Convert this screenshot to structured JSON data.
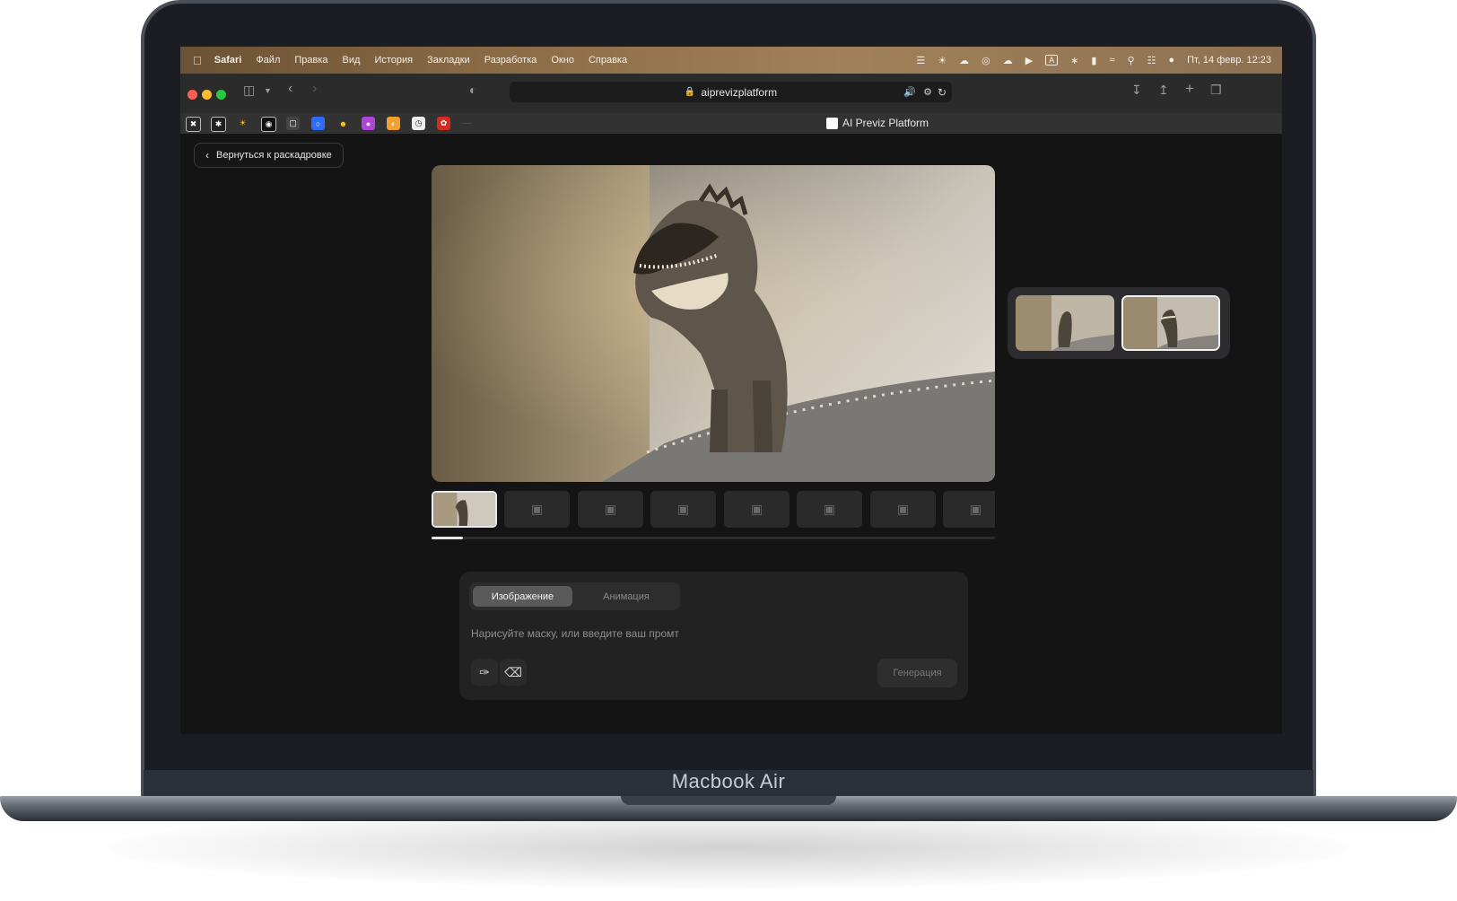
{
  "device": {
    "model_label": "Macbook Air"
  },
  "menubar": {
    "apple_icon": "apple-icon",
    "app_name": "Safari",
    "items": [
      "Файл",
      "Правка",
      "Вид",
      "История",
      "Закладки",
      "Разработка",
      "Окно",
      "Справка"
    ],
    "status_icons": [
      "figma-icon",
      "brightness-icon",
      "cloud-sync-icon",
      "eye-icon",
      "cloud-icon",
      "play-icon",
      "keyboard-layout-icon",
      "bluetooth-icon",
      "battery-icon",
      "wifi-icon",
      "search-icon",
      "control-center-icon",
      "siri-icon"
    ],
    "keyboard_layout": "A",
    "datetime": "Пт, 14 февр.  12:23"
  },
  "toolbar": {
    "url": "aiprevizplatform"
  },
  "tabbar": {
    "favorites": [
      "cursor-icon",
      "perplexity-icon",
      "sun-icon",
      "chatgpt-icon",
      "bubble-icon",
      "blue-app-icon",
      "emoji-icon",
      "figma-app-icon",
      "gradient-app-icon",
      "clock-app-icon",
      "red-app-icon",
      "line-icon"
    ],
    "active_tab_title": "AI Previz Platform"
  },
  "page": {
    "back_button_label": "Вернуться к раскадровке",
    "frame_count": 8,
    "active_frame": 1,
    "scroll_progress": 0.055,
    "variants_count": 2,
    "selected_variant": 2,
    "mode_tabs": [
      "Изображение",
      "Анимация"
    ],
    "active_mode": "Изображение",
    "prompt_placeholder": "Нарисуйте маску, или введите ваш промт",
    "generate_label": "Генерация"
  },
  "colors": {
    "background": "#141414",
    "panel": "#222222",
    "accent_active_tab": "#5a5a5a",
    "close": "#ff5f57",
    "minimize": "#febc2e",
    "zoom": "#28c840"
  }
}
